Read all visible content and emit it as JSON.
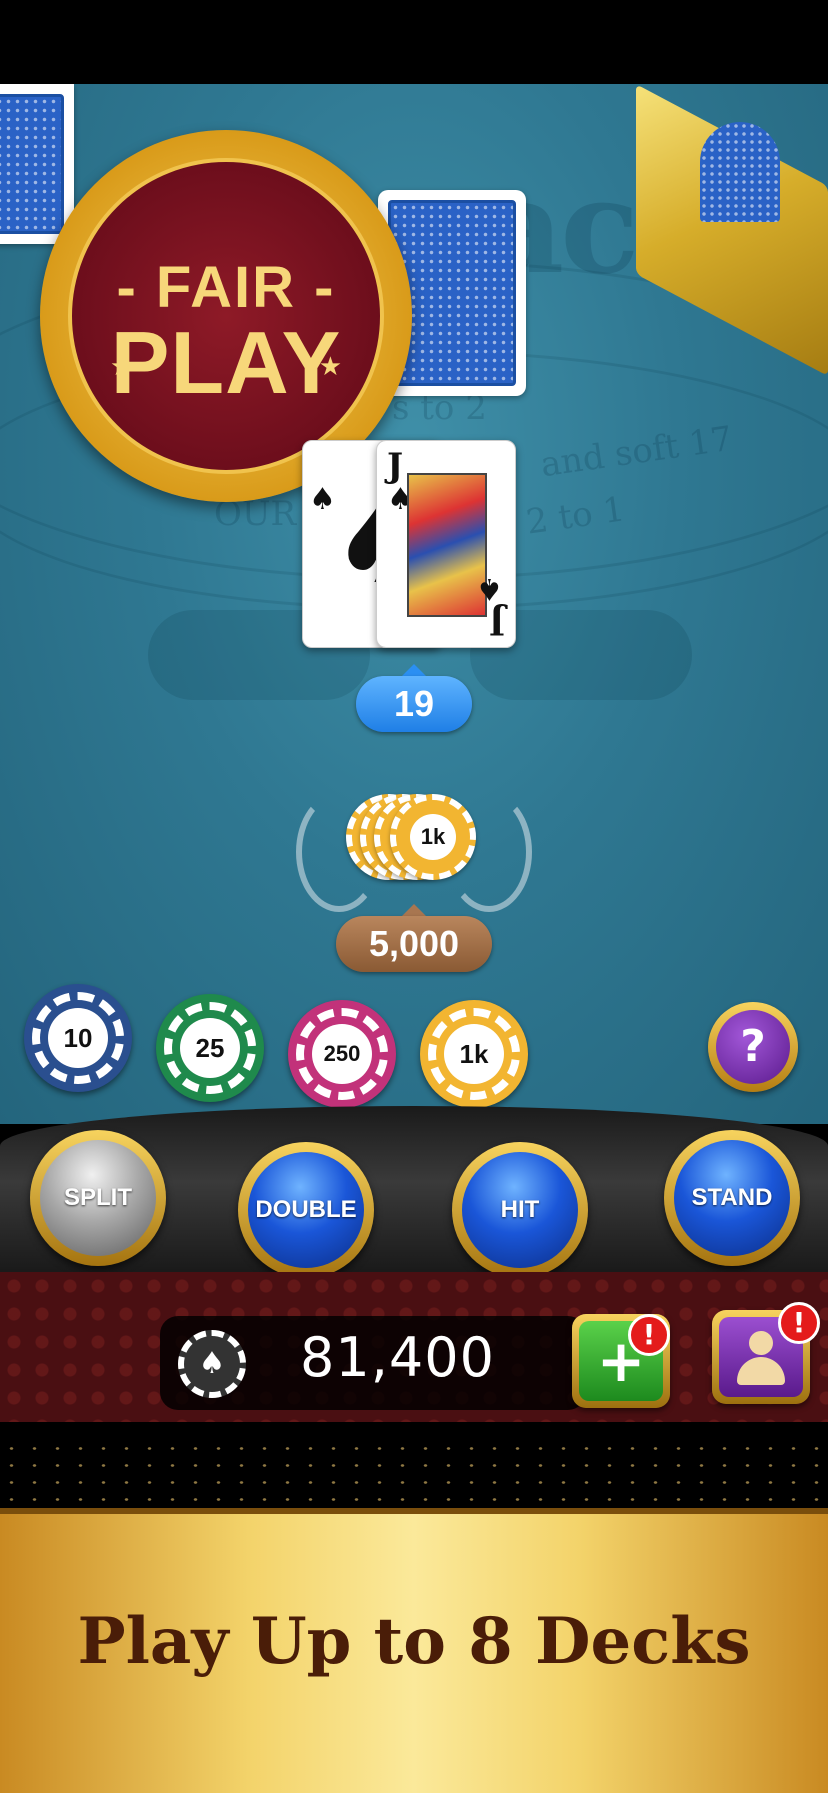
{
  "badge": {
    "line1": "- FAIR -",
    "line2": "PLAY"
  },
  "felt": {
    "title": "ack",
    "line1": "s to 2",
    "line2": "and soft 17",
    "line3": "OUR",
    "line4": "2 to 1"
  },
  "hand": {
    "cards": [
      {
        "rank": "",
        "suit": "♠"
      },
      {
        "rank": "J",
        "suit": "♠"
      }
    ],
    "total": "19"
  },
  "bet": {
    "chip_label": "1k",
    "amount": "5,000"
  },
  "chips": [
    {
      "label": "10",
      "color": "#2a4f8f"
    },
    {
      "label": "25",
      "color": "#1f8a4c"
    },
    {
      "label": "250",
      "color": "#c2327a"
    },
    {
      "label": "1k",
      "color": "#f2b531"
    }
  ],
  "help": {
    "label": "?"
  },
  "actions": {
    "split": "SPLIT",
    "double": "DOUBLE",
    "hit": "HIT",
    "stand": "STAND"
  },
  "balance": {
    "value": "81,400",
    "chip_icon": "♠"
  },
  "buttons": {
    "add_label": "+",
    "alert": "!"
  },
  "promo": {
    "text": "Play Up to 8 Decks"
  }
}
